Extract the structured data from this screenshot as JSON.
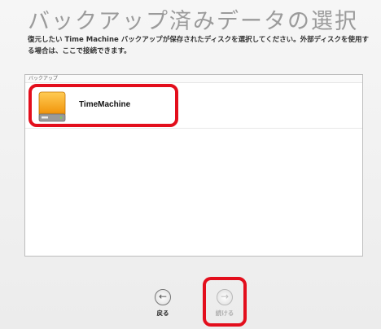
{
  "header": {
    "title": "バックアップ済みデータの選択",
    "description": "復元したい Time Machine バックアップが保存されたディスクを選択してください。外部ディスクを使用する場合は、ここで接続できます。"
  },
  "backup_list": {
    "header_label": "バックアップ",
    "items": [
      {
        "label": "TimeMachine",
        "icon": "hard-disk-icon",
        "selected": true
      }
    ]
  },
  "navigation": {
    "back_label": "戻る",
    "back_icon": "arrow-left-icon",
    "continue_label": "続ける",
    "continue_icon": "arrow-right-icon",
    "continue_enabled": false
  },
  "colors": {
    "highlight": "#e30e1c",
    "disk": "#f5a623"
  }
}
